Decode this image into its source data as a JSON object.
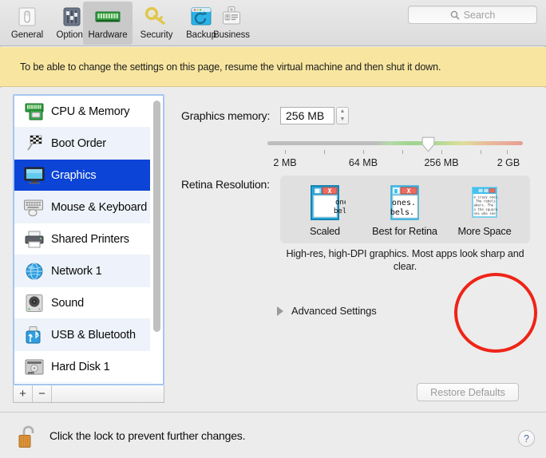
{
  "toolbar": {
    "tabs": [
      {
        "label": "General",
        "icon": "general-switch-icon"
      },
      {
        "label": "Options",
        "icon": "sliders-icon"
      },
      {
        "label": "Hardware",
        "icon": "memory-module-icon"
      },
      {
        "label": "Security",
        "icon": "key-icon"
      },
      {
        "label": "Backup",
        "icon": "backup-window-icon"
      },
      {
        "label": "Business",
        "icon": "id-card-icon"
      }
    ],
    "selected_tab": "Hardware",
    "search": {
      "placeholder": "Search",
      "value": "",
      "icon": "search-icon"
    }
  },
  "warning": {
    "text": "To be able to change the settings on this page, resume the virtual machine and then shut it down.",
    "background": "#f8e6a0"
  },
  "sidebar": {
    "items": [
      {
        "label": "CPU & Memory",
        "icon": "cpu-chip-icon",
        "selected": false
      },
      {
        "label": "Boot Order",
        "icon": "checkered-flag-icon",
        "selected": false
      },
      {
        "label": "Graphics",
        "icon": "display-icon",
        "selected": true
      },
      {
        "label": "Mouse & Keyboard",
        "icon": "keyboard-mouse-icon",
        "selected": false
      },
      {
        "label": "Shared Printers",
        "icon": "printer-icon",
        "selected": false
      },
      {
        "label": "Network 1",
        "icon": "globe-icon",
        "selected": false
      },
      {
        "label": "Sound",
        "icon": "speaker-icon",
        "selected": false
      },
      {
        "label": "USB & Bluetooth",
        "icon": "usb-bluetooth-icon",
        "selected": false
      },
      {
        "label": "Hard Disk 1",
        "icon": "hard-disk-icon",
        "selected": false
      }
    ],
    "selection_color": "#0b44d6",
    "add_button": "+",
    "remove_button": "−"
  },
  "graphics": {
    "memory_label": "Graphics memory:",
    "memory_value": "256 MB",
    "stepper_up": "▲",
    "stepper_down": "▼",
    "slider": {
      "ticks": [
        "2 MB",
        "",
        "64 MB",
        "",
        "256 MB",
        "",
        "2 GB"
      ],
      "tick_labels_shown": [
        "2 MB",
        "64 MB",
        "256 MB",
        "2 GB"
      ],
      "current": "256 MB",
      "knob_position_percent": 60
    },
    "retina_label": "Retina Resolution:",
    "retina_options": [
      {
        "label": "Scaled",
        "selected": false
      },
      {
        "label": "Best for Retina",
        "selected": true
      },
      {
        "label": "More Space",
        "selected": false
      }
    ],
    "retina_description": "High-res, high-DPI graphics. Most apps look sharp and clear.",
    "thumbnail_text": {
      "line1": "ones.",
      "line2": "bels."
    },
    "thumbnail_dense_text": [
      "e crazy ones.",
      "The rebels.",
      "akers. The",
      "n the square",
      "nes who see"
    ],
    "advanced_settings": "Advanced Settings",
    "restore_defaults": "Restore Defaults",
    "restore_defaults_disabled": true
  },
  "annotation": {
    "shape": "circle",
    "color": "#ef2418",
    "target": "Best for Retina"
  },
  "bottom": {
    "lock_text": "Click the lock to prevent further changes.",
    "lock_icon": "open-padlock-icon",
    "help_label": "?"
  }
}
